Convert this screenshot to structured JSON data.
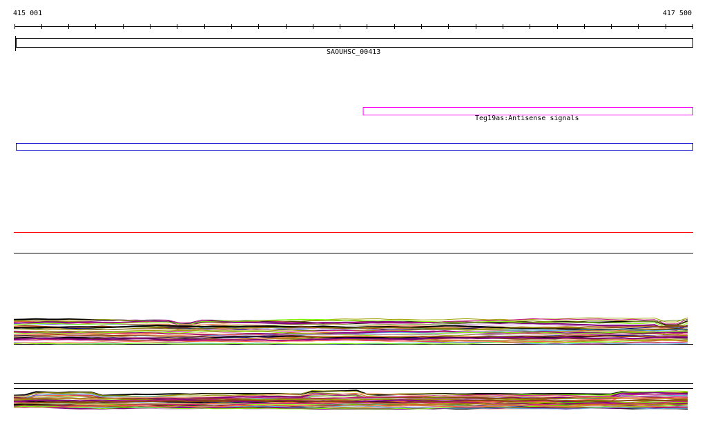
{
  "ruler": {
    "start_label": "415 001",
    "end_label": "417 500",
    "start": 415001,
    "end": 417500,
    "tick_interval_bp": 100
  },
  "features": [
    {
      "name": "SAOUHSC_00413",
      "color": "#000000",
      "start": 415001,
      "end": 417500
    },
    {
      "name": "Teg19as:Antisense signals",
      "color": "#ff00ff",
      "start": 416280,
      "end": 417500
    },
    {
      "name": "",
      "color": "#0000cc",
      "start": 415001,
      "end": 417500
    }
  ],
  "colors": {
    "red_line": "#ff0000",
    "track_border": "#000000",
    "palette": [
      "#000000",
      "#8b8b00",
      "#c080c0",
      "#a0a000",
      "#d2691e",
      "#800080",
      "#c71585",
      "#5fb4e8",
      "#7cfc00",
      "#ff6347",
      "#8b4513",
      "#ffa07a",
      "#6b8e23",
      "#000080",
      "#cd853f"
    ]
  }
}
